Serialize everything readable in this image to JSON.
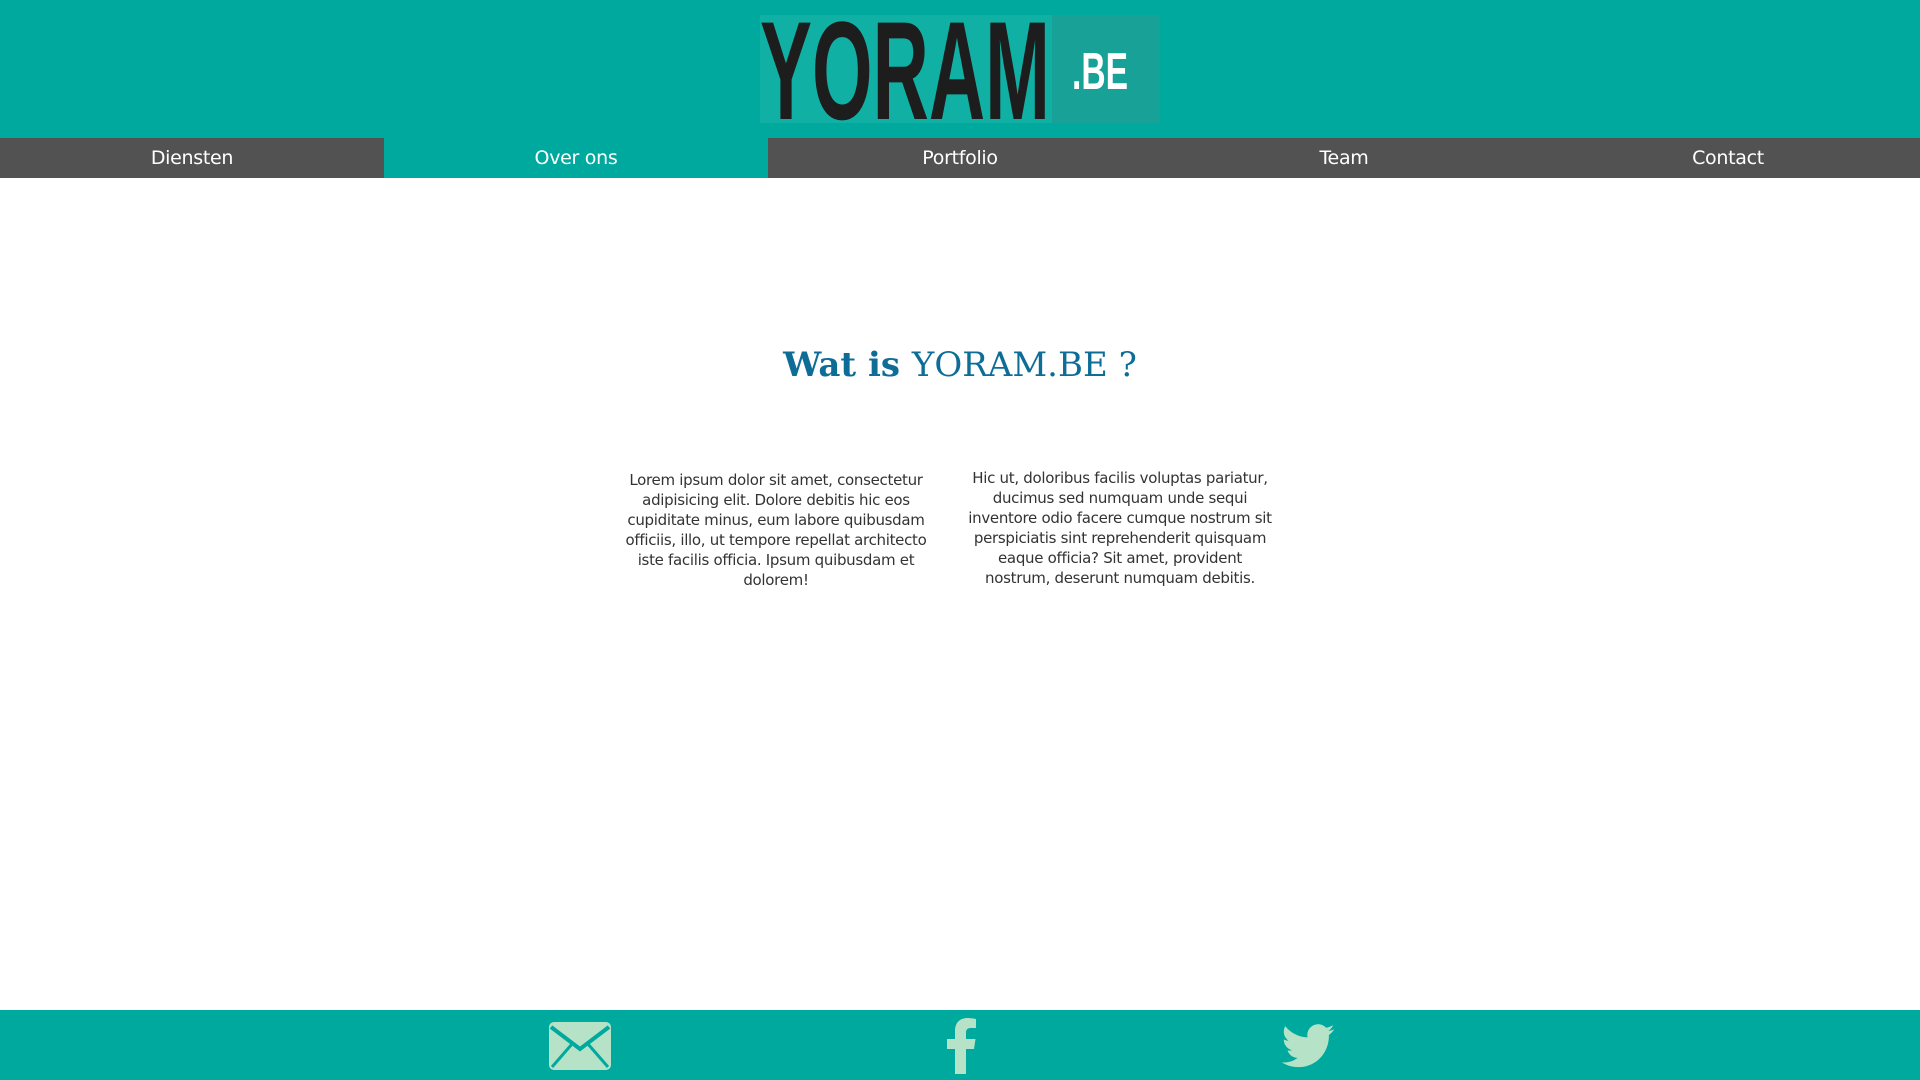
{
  "logo": {
    "main": "YORAM",
    "suffix": ".BE"
  },
  "nav": {
    "items": [
      {
        "label": "Diensten"
      },
      {
        "label": "Over ons"
      },
      {
        "label": "Portfolio"
      },
      {
        "label": "Team"
      },
      {
        "label": "Contact"
      }
    ],
    "active": "Over ons"
  },
  "main": {
    "heading_prefix": "Wat is",
    "heading_brand": "YORAM.BE ?",
    "col_left": "Lorem ipsum dolor sit amet, consectetur adipisicing elit. Dolore debitis hic eos cupiditate minus, eum labore quibusdam officiis, illo, ut tempore repellat architecto iste facilis officia. Ipsum quibusdam et dolorem!",
    "col_right": "Hic ut, doloribus facilis voluptas pariatur, ducimus sed numquam unde sequi inventore odio facere cumque nostrum sit perspiciatis sint reprehenderit quisquam eaque officia? Sit amet, provident nostrum, deserunt numquam debitis."
  },
  "footer": {
    "icons": [
      "mail-icon",
      "facebook-icon",
      "twitter-icon"
    ]
  },
  "colors": {
    "brand_teal": "#00a99d",
    "nav_gray": "#525252",
    "heading_blue": "#0e6d97",
    "icon_mint": "#b6e3c8",
    "logo_dark": "#1d1d1d"
  }
}
